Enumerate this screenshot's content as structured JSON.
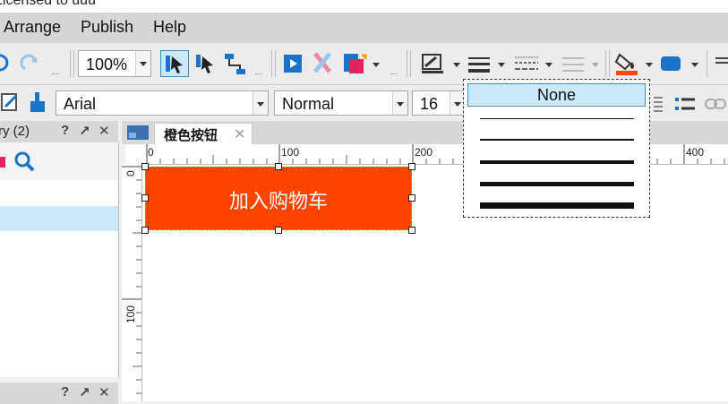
{
  "window": {
    "title_partial": "Licensed to uuu"
  },
  "menu": [
    "Arrange",
    "Publish",
    "Help"
  ],
  "toolbar1": {
    "zoom": "100%"
  },
  "toolbar2": {
    "font_family": "Arial",
    "font_style": "Normal",
    "font_size": "16"
  },
  "panels": {
    "top": {
      "title": "ry (2)",
      "help": "?",
      "pin": "↗",
      "close": "✕"
    },
    "bottom": {
      "help": "?",
      "pin": "↗",
      "close": "✕"
    }
  },
  "tabs": [
    {
      "label": "橙色按钮",
      "close": "✕"
    }
  ],
  "ruler": {
    "h_labels": [
      "0",
      "100",
      "200",
      "400"
    ],
    "v_labels": [
      "0",
      "100"
    ]
  },
  "canvas": {
    "button_text": "加入购物车"
  },
  "line_popup": {
    "none_label": "None"
  },
  "colors": {
    "accent_orange": "#fe4500",
    "selection_blue": "#cde8f6"
  }
}
